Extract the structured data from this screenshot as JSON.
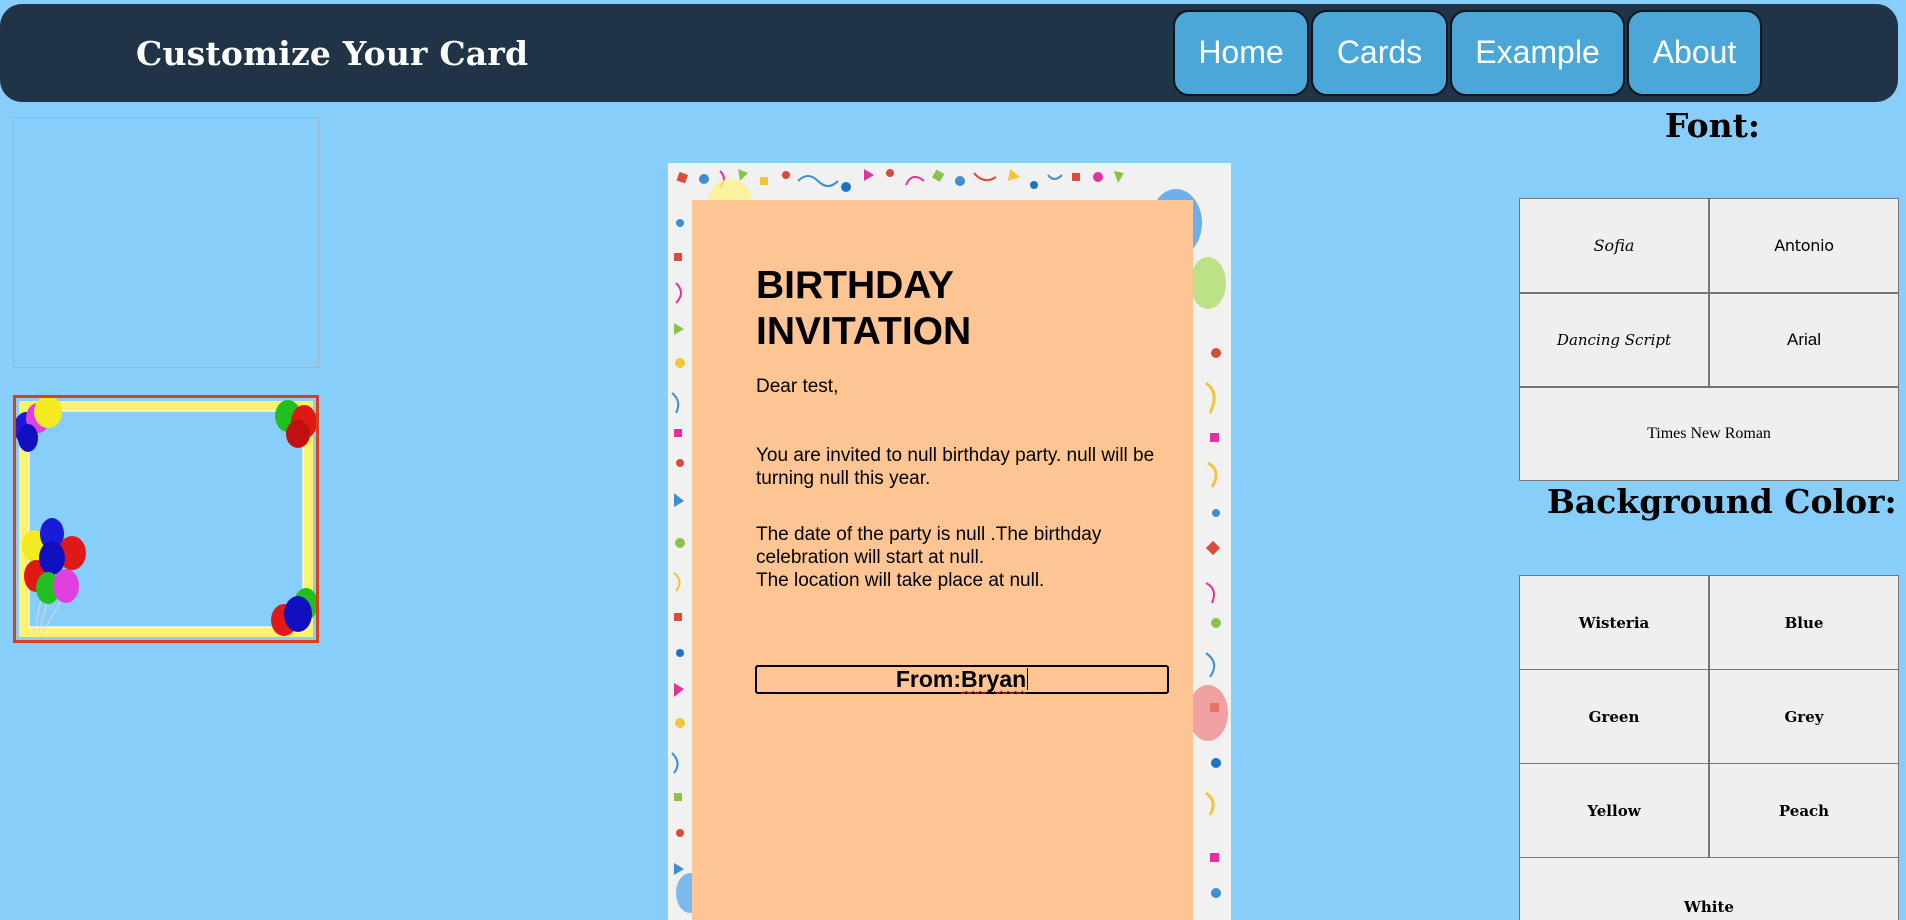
{
  "header": {
    "title": "Customize Your Card",
    "nav": [
      {
        "label": "Home"
      },
      {
        "label": "Cards"
      },
      {
        "label": "Example"
      },
      {
        "label": "About"
      }
    ]
  },
  "templates": [
    {
      "name": "blank-template"
    },
    {
      "name": "balloon-frame-template"
    }
  ],
  "card": {
    "title": "BIRTHDAY INVITATION",
    "greeting": "Dear test,",
    "paragraph1": "You are invited to null birthday party. null will be turning null this year.",
    "paragraph2_line1": "The date of the party is null .The birthday celebration will start at null.",
    "paragraph2_line2": "The location will take place at null.",
    "from_prefix": "From:",
    "from_name": "Bryan"
  },
  "font_panel": {
    "heading": "Font:",
    "options": [
      "Sofia",
      "Antonio",
      "Dancing Script",
      "Arial",
      "Times New Roman"
    ]
  },
  "color_panel": {
    "heading": "Background Color:",
    "options": [
      "Wisteria",
      "Blue",
      "Green",
      "Grey",
      "Yellow",
      "Peach",
      "White"
    ]
  },
  "colors": {
    "page_background": "#87cefa",
    "header_background": "#213447",
    "nav_button": "#4aa7d8",
    "card_background": "#fdc593",
    "card_border": "#f1f1f1",
    "option_button": "#efefef"
  }
}
